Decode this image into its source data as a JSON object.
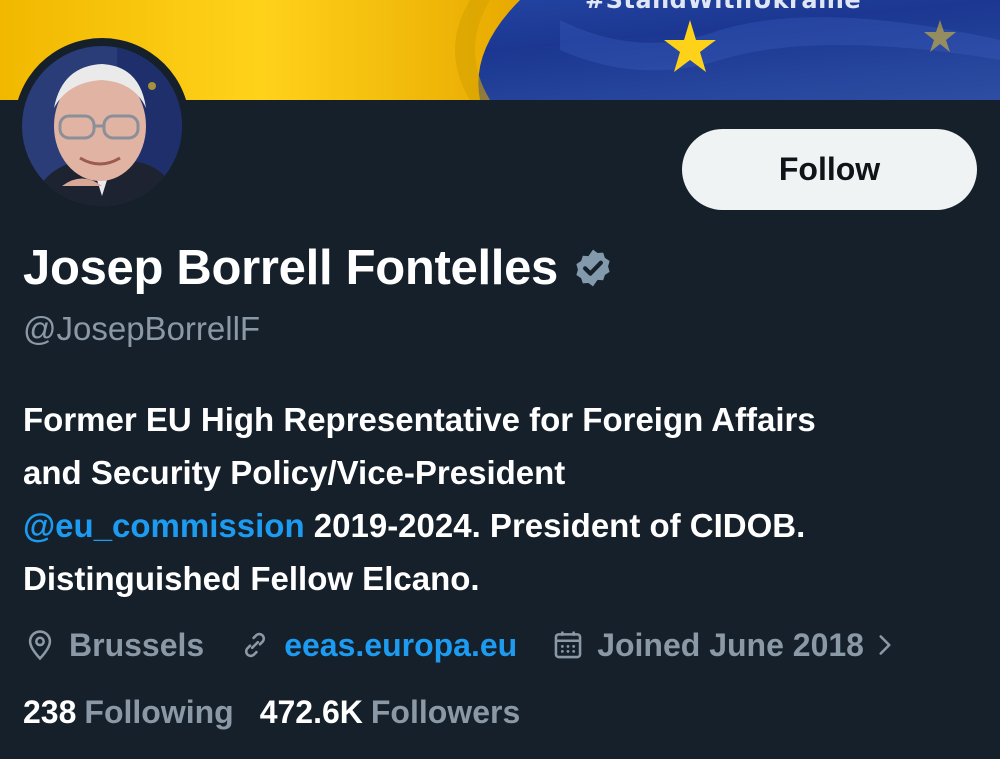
{
  "banner": {
    "hashtag": "#StandWithUkraine"
  },
  "profile": {
    "display_name": "Josep Borrell Fontelles",
    "handle": "@JosepBorrellF",
    "verified_icon": "verified-badge-icon",
    "follow_label": "Follow"
  },
  "bio": {
    "line1": "Former EU High Representative for Foreign Affairs",
    "line2": "and Security Policy/Vice-President",
    "mention": "@eu_commission",
    "line3_rest": " 2019-2024. President of CIDOB.",
    "line4": "Distinguished Fellow Elcano."
  },
  "meta": {
    "location": "Brussels",
    "website": "eeas.europa.eu",
    "joined": "Joined June 2018"
  },
  "stats": {
    "following_count": "238",
    "following_label": "Following",
    "followers_count": "472.6K",
    "followers_label": "Followers"
  },
  "colors": {
    "background": "#15202b",
    "accent": "#1d9bf0",
    "muted": "#8b98a5",
    "ukraine_yellow": "#f5c518",
    "eu_blue": "#1f3a93"
  }
}
